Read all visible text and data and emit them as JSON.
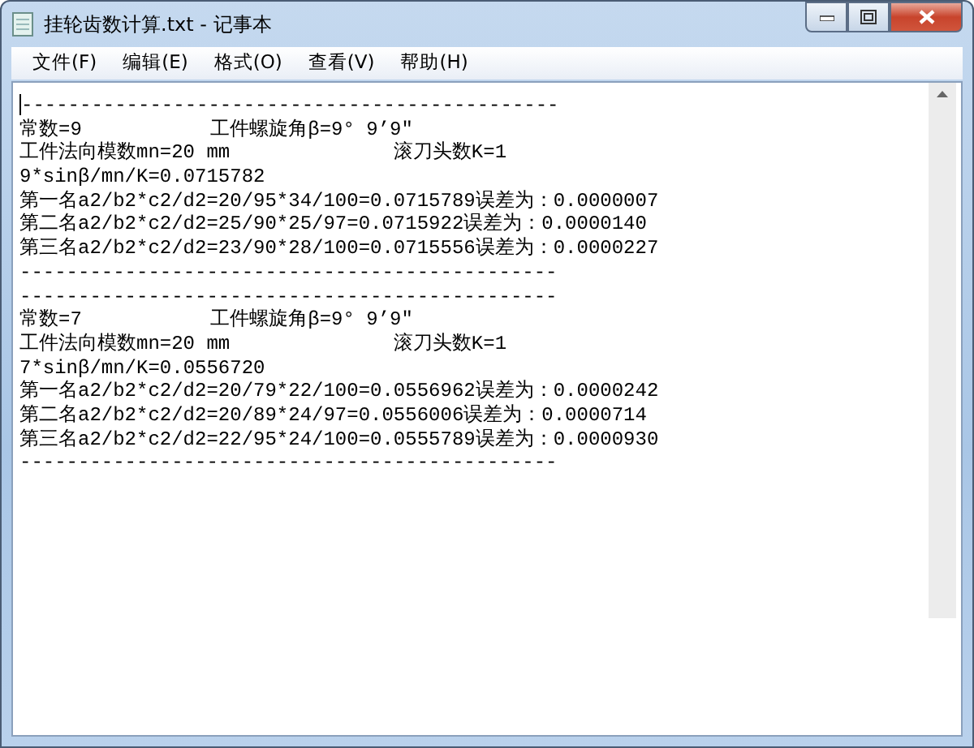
{
  "window": {
    "title": "挂轮齿数计算.txt - 记事本"
  },
  "menu": [
    {
      "label": "文件(F)"
    },
    {
      "label": "编辑(E)"
    },
    {
      "label": "格式(O)"
    },
    {
      "label": "查看(V)"
    },
    {
      "label": "帮助(H)"
    }
  ],
  "document": {
    "lines": [
      "----------------------------------------------",
      "常数=9           工件螺旋角β=9° 9’9″",
      "工件法向模数mn=20 mm              滚刀头数K=1",
      "9*sinβ/mn/K=0.0715782",
      "第一名a2/b2*c2/d2=20/95*34/100=0.0715789误差为：0.0000007",
      "第二名a2/b2*c2/d2=25/90*25/97=0.0715922误差为：0.0000140",
      "第三名a2/b2*c2/d2=23/90*28/100=0.0715556误差为：0.0000227",
      "----------------------------------------------",
      "----------------------------------------------",
      "常数=7           工件螺旋角β=9° 9’9″",
      "工件法向模数mn=20 mm              滚刀头数K=1",
      "7*sinβ/mn/K=0.0556720",
      "第一名a2/b2*c2/d2=20/79*22/100=0.0556962误差为：0.0000242",
      "第二名a2/b2*c2/d2=20/89*24/97=0.0556006误差为：0.0000714",
      "第三名a2/b2*c2/d2=22/95*24/100=0.0555789误差为：0.0000930",
      "----------------------------------------------"
    ]
  }
}
